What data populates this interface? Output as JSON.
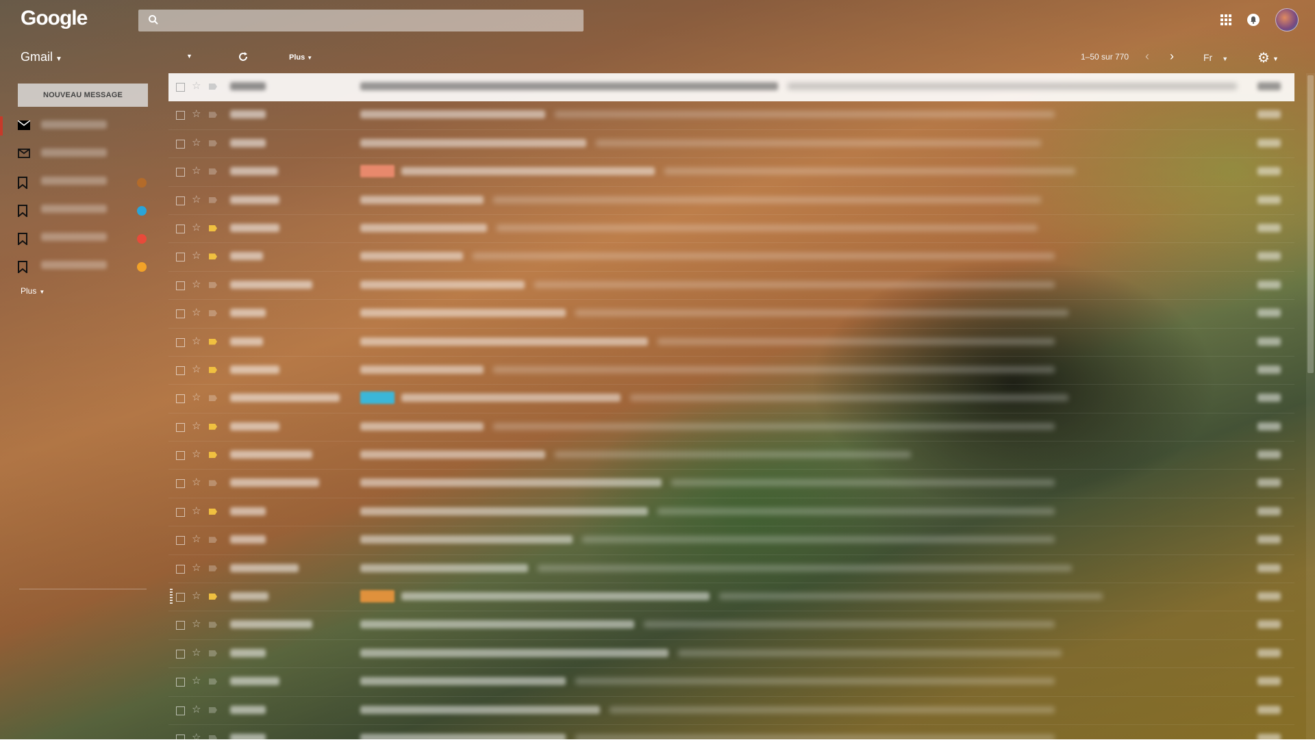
{
  "header": {
    "logo": "Google",
    "search_placeholder": "",
    "account_icon": "avatar"
  },
  "toolbar": {
    "app_name": "Gmail",
    "more_label": "Plus",
    "pagination": "1–50 sur 770",
    "language": "Fr"
  },
  "sidebar": {
    "compose_label": "NOUVEAU MESSAGE",
    "items": [
      {
        "icon": "inbox-icon",
        "active": true,
        "dot": null
      },
      {
        "icon": "mail-icon",
        "active": false,
        "dot": null
      },
      {
        "icon": "label-icon",
        "active": false,
        "dot": "#b36b2a"
      },
      {
        "icon": "label-icon",
        "active": false,
        "dot": "#2aa4d8"
      },
      {
        "icon": "label-icon",
        "active": false,
        "dot": "#e84a3a"
      },
      {
        "icon": "label-icon",
        "active": false,
        "dot": "#f2a228"
      }
    ],
    "more_label": "Plus"
  },
  "email_list": {
    "rows": [
      {
        "important": false,
        "sender_w": 52,
        "subject_w": 610,
        "snippet_w": 690,
        "tag": null
      },
      {
        "important": false,
        "sender_w": 52,
        "subject_w": 270,
        "snippet_w": 730,
        "tag": null
      },
      {
        "important": false,
        "sender_w": 52,
        "subject_w": 330,
        "snippet_w": 650,
        "tag": null
      },
      {
        "important": false,
        "sender_w": 70,
        "subject_w": 370,
        "snippet_w": 600,
        "tag": "#e8896c"
      },
      {
        "important": false,
        "sender_w": 72,
        "subject_w": 180,
        "snippet_w": 800,
        "tag": null
      },
      {
        "important": true,
        "sender_w": 72,
        "subject_w": 185,
        "snippet_w": 790,
        "tag": null
      },
      {
        "important": true,
        "sender_w": 48,
        "subject_w": 150,
        "snippet_w": 850,
        "tag": null
      },
      {
        "important": false,
        "sender_w": 120,
        "subject_w": 240,
        "snippet_w": 760,
        "tag": null
      },
      {
        "important": false,
        "sender_w": 52,
        "subject_w": 300,
        "snippet_w": 720,
        "tag": null
      },
      {
        "important": true,
        "sender_w": 48,
        "subject_w": 420,
        "snippet_w": 580,
        "tag": null
      },
      {
        "important": true,
        "sender_w": 72,
        "subject_w": 180,
        "snippet_w": 820,
        "tag": null
      },
      {
        "important": false,
        "sender_w": 160,
        "subject_w": 320,
        "snippet_w": 640,
        "tag": "#3bb6d8"
      },
      {
        "important": true,
        "sender_w": 72,
        "subject_w": 180,
        "snippet_w": 820,
        "tag": null
      },
      {
        "important": true,
        "sender_w": 120,
        "subject_w": 270,
        "snippet_w": 520,
        "tag": null
      },
      {
        "important": false,
        "sender_w": 130,
        "subject_w": 440,
        "snippet_w": 560,
        "tag": null
      },
      {
        "important": true,
        "sender_w": 52,
        "subject_w": 420,
        "snippet_w": 580,
        "tag": null
      },
      {
        "important": false,
        "sender_w": 52,
        "subject_w": 310,
        "snippet_w": 690,
        "tag": null
      },
      {
        "important": false,
        "sender_w": 100,
        "subject_w": 245,
        "snippet_w": 780,
        "tag": null
      },
      {
        "important": true,
        "sender_w": 56,
        "subject_w": 450,
        "snippet_w": 560,
        "tag": "#e0913c",
        "drag": true
      },
      {
        "important": false,
        "sender_w": 120,
        "subject_w": 400,
        "snippet_w": 600,
        "tag": null
      },
      {
        "important": false,
        "sender_w": 52,
        "subject_w": 450,
        "snippet_w": 560,
        "tag": null
      },
      {
        "important": false,
        "sender_w": 72,
        "subject_w": 300,
        "snippet_w": 700,
        "tag": null
      },
      {
        "important": false,
        "sender_w": 52,
        "subject_w": 350,
        "snippet_w": 650,
        "tag": null
      },
      {
        "important": false,
        "sender_w": 52,
        "subject_w": 300,
        "snippet_w": 700,
        "tag": null
      }
    ]
  }
}
